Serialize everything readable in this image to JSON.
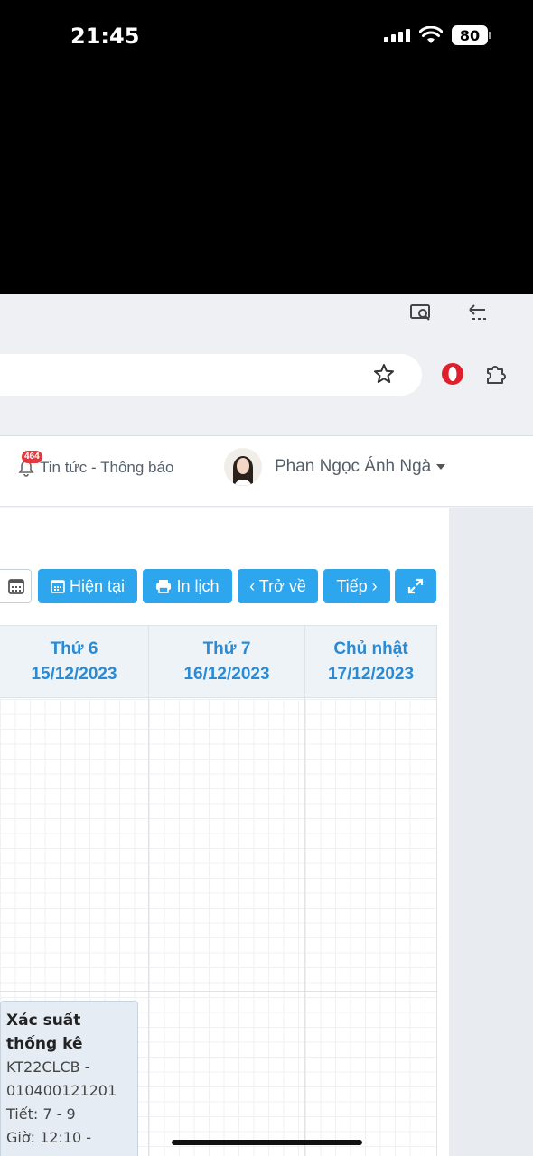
{
  "status_bar": {
    "time": "21:45",
    "battery": "80"
  },
  "header": {
    "notification_count": "464",
    "news_label": "Tin tức - Thông báo",
    "user_name": "Phan Ngọc Ánh Ngà"
  },
  "toolbar": {
    "buttons": [
      {
        "label": "Hiện tại",
        "icon": "calendar-icon"
      },
      {
        "label": "In lịch",
        "icon": "print-icon"
      },
      {
        "label": "‹ Trở về"
      },
      {
        "label": "Tiếp ›"
      },
      {
        "label": "",
        "icon": "expand-icon"
      }
    ]
  },
  "calendar": {
    "columns": [
      {
        "day": "Thứ 6",
        "date": "15/12/2023"
      },
      {
        "day": "Thứ 7",
        "date": "16/12/2023"
      },
      {
        "day": "Chủ nhật",
        "date": "17/12/2023"
      }
    ],
    "event": {
      "title": "Xác suất thống kê",
      "lines": [
        "KT22CLCB -",
        "010400121201",
        "Tiết: 7 - 9",
        "Giờ: 12:10 -"
      ]
    }
  },
  "colors": {
    "accent": "#2da6ee",
    "header_text": "#2a8ad3",
    "badge": "#e0393e"
  }
}
